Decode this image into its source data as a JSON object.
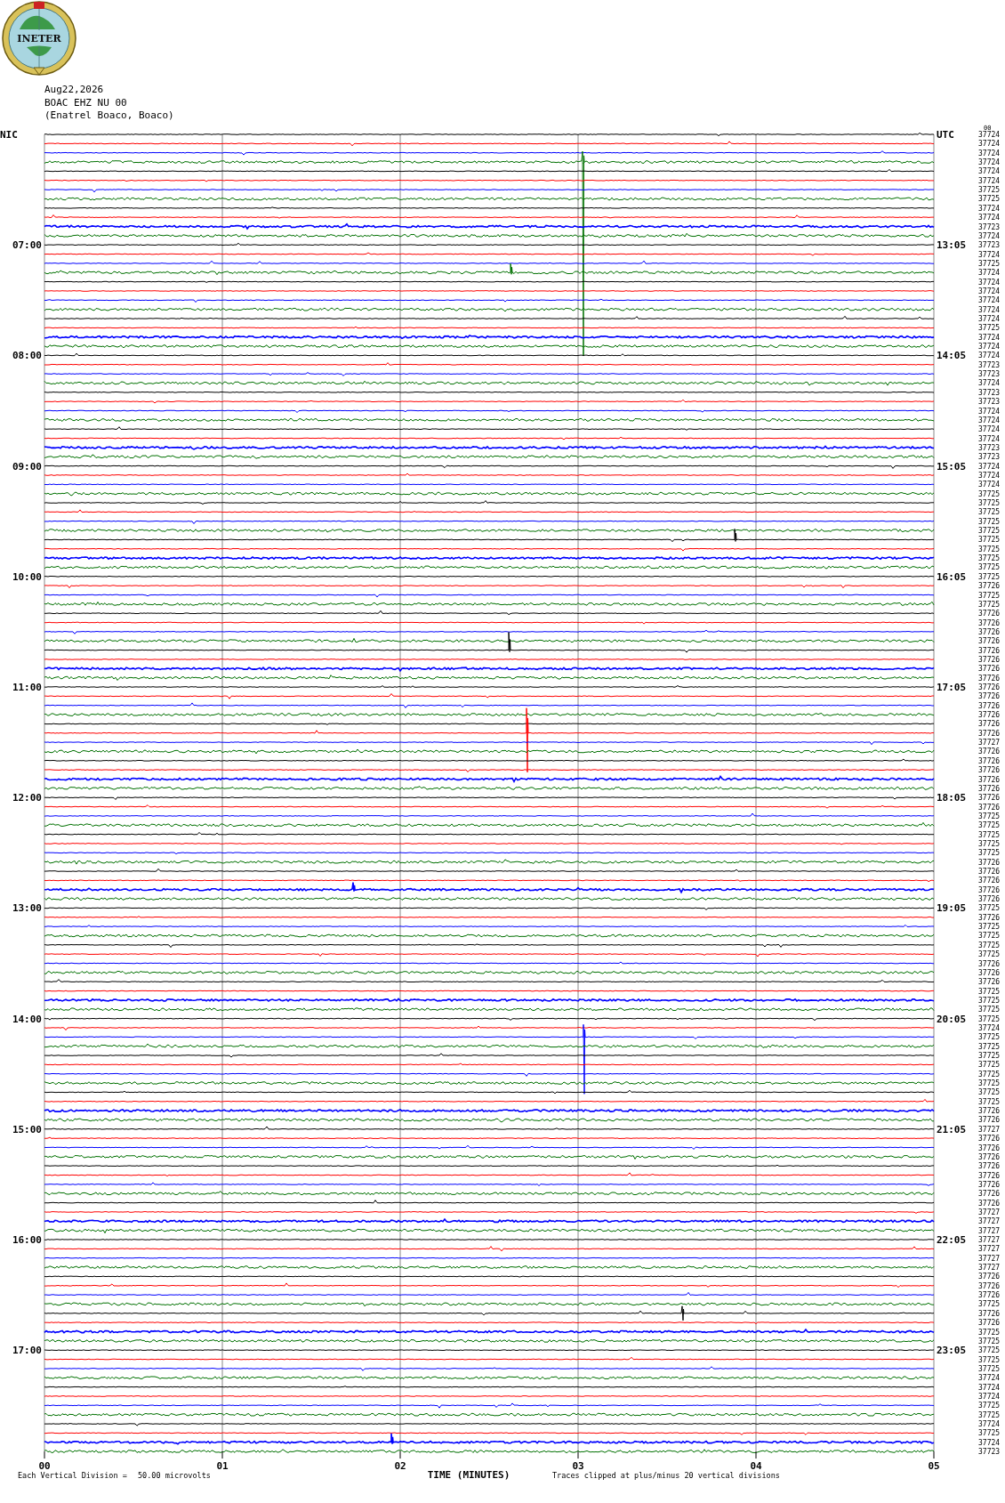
{
  "logo": {
    "text": "INETER"
  },
  "header": {
    "date": "Aug22,2026",
    "channel": "BOAC EHZ NU 00",
    "station": "(Enatrel Boaco, Boaco)"
  },
  "helicorder": {
    "left_title": "NIC",
    "right_title": "UTC",
    "overlay_label": "00",
    "left_times": [
      "07:00",
      "08:00",
      "09:00",
      "10:00",
      "11:00",
      "12:00",
      "13:00",
      "14:00",
      "15:00",
      "16:00",
      "17:00"
    ],
    "right_times": [
      "13:05",
      "14:05",
      "15:05",
      "16:05",
      "17:05",
      "18:05",
      "19:05",
      "20:05",
      "21:05",
      "22:05",
      "23:05"
    ],
    "trace_readings": [
      "37724",
      "37724",
      "37724",
      "37724",
      "37724",
      "37724",
      "37725",
      "37725",
      "37724",
      "37724",
      "37723",
      "37724",
      "37723",
      "37724",
      "37725",
      "37724",
      "37724",
      "37724",
      "37724",
      "37724",
      "37724",
      "37725",
      "37724",
      "37724",
      "37724",
      "37723",
      "37723",
      "37724",
      "37723",
      "37723",
      "37724",
      "37724",
      "37724",
      "37724",
      "37723",
      "37723",
      "37724",
      "37724",
      "37724",
      "37725",
      "37725",
      "37725",
      "37725",
      "37725",
      "37725",
      "37725",
      "37725",
      "37725",
      "37725",
      "37726",
      "37725",
      "37725",
      "37726",
      "37726",
      "37726",
      "37726",
      "37726",
      "37726",
      "37726",
      "37726",
      "37726",
      "37726",
      "37726",
      "37726",
      "37726",
      "37726",
      "37727",
      "37726",
      "37726",
      "37726",
      "37726",
      "37726",
      "37726",
      "37726",
      "37725",
      "37725",
      "37725",
      "37725",
      "37725",
      "37726",
      "37726",
      "37726",
      "37726",
      "37726",
      "37725",
      "37726",
      "37725",
      "37725",
      "37725",
      "37725",
      "37726",
      "37726",
      "37726",
      "37725",
      "37725",
      "37725",
      "37725",
      "37724",
      "37725",
      "37725",
      "37725",
      "37725",
      "37725",
      "37725",
      "37725",
      "37725",
      "37726",
      "37726",
      "37727",
      "37726",
      "37726",
      "37726",
      "37726",
      "37726",
      "37726",
      "37726",
      "37726",
      "37727",
      "37727",
      "37727",
      "37727",
      "37727",
      "37727",
      "37727",
      "37726",
      "37726",
      "37726",
      "37725",
      "37726",
      "37726",
      "37725",
      "37725",
      "37725",
      "37725",
      "37725",
      "37724",
      "37724",
      "37724",
      "37725",
      "37725",
      "37724",
      "37725",
      "37724",
      "37723"
    ],
    "x_ticks": [
      "00",
      "01",
      "02",
      "03",
      "04",
      "05"
    ],
    "x_axis_title": "TIME (MINUTES)",
    "scale_label": "Each Vertical Division =",
    "scale_value": "50.00 microvolts",
    "clip_note": "Traces clipped at plus/minus 20 vertical divisions"
  }
}
